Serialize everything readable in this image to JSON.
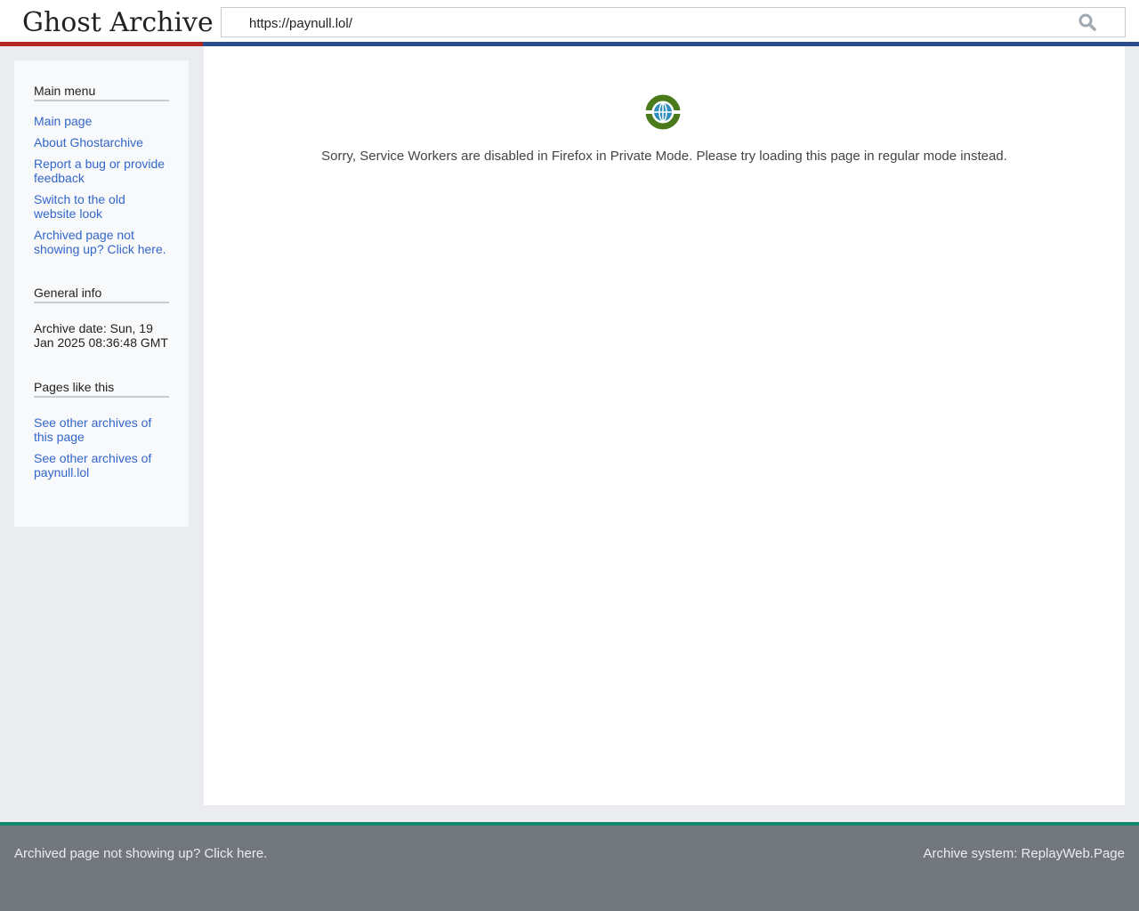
{
  "header": {
    "logo": "Ghost Archive",
    "url": "https://paynull.lol/"
  },
  "sidebar": {
    "main_menu": {
      "title": "Main menu",
      "items": [
        "Main page",
        "About Ghostarchive",
        "Report a bug or provide feedback",
        "Switch to the old website look",
        "Archived page not showing up? Click here."
      ]
    },
    "general_info": {
      "title": "General info",
      "archive_date": "Archive date: Sun, 19 Jan 2025 08:36:48 GMT"
    },
    "pages_like_this": {
      "title": "Pages like this",
      "items": [
        "See other archives of this page",
        "See other archives of paynull.lol"
      ]
    }
  },
  "main": {
    "message": "Sorry, Service Workers are disabled in Firefox in Private Mode. Please try loading this page in regular mode instead."
  },
  "footer": {
    "left": "Archived page not showing up? Click here.",
    "right": "Archive system: ReplayWeb.Page"
  },
  "colors": {
    "logo_bar": "#b32424",
    "url_bar": "#2a4b8d",
    "link": "#3366cc",
    "footer": "#72777d",
    "footer_border": "#14866d"
  }
}
